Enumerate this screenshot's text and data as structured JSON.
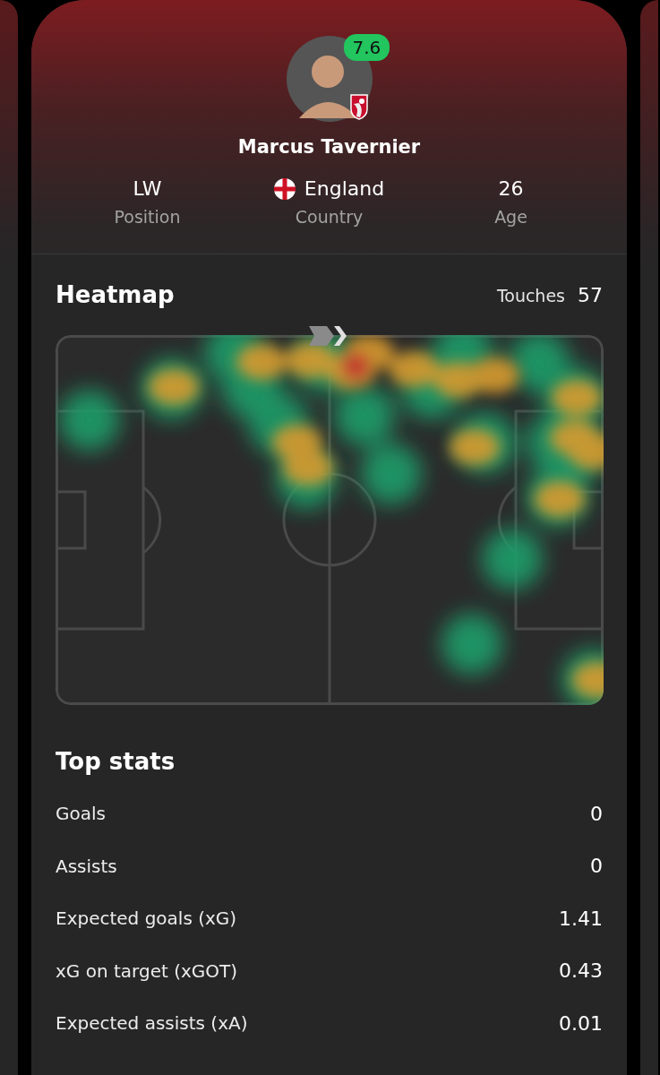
{
  "player": {
    "rating": "7.6",
    "name": "Marcus Tavernier"
  },
  "facts": [
    {
      "value": "LW",
      "label": "Position",
      "kind": "plain"
    },
    {
      "value": "England",
      "label": "Country",
      "kind": "flag"
    },
    {
      "value": "26",
      "label": "Age",
      "kind": "plain"
    }
  ],
  "heatmap": {
    "title": "Heatmap",
    "touches_label": "Touches",
    "touches": "57"
  },
  "top_stats": {
    "title": "Top stats",
    "rows": [
      {
        "label": "Goals",
        "value": "0"
      },
      {
        "label": "Assists",
        "value": "0"
      },
      {
        "label": "Expected goals (xG)",
        "value": "1.41"
      },
      {
        "label": "xG on target (xGOT)",
        "value": "0.43"
      },
      {
        "label": "Expected assists (xA)",
        "value": "0.01"
      }
    ]
  }
}
